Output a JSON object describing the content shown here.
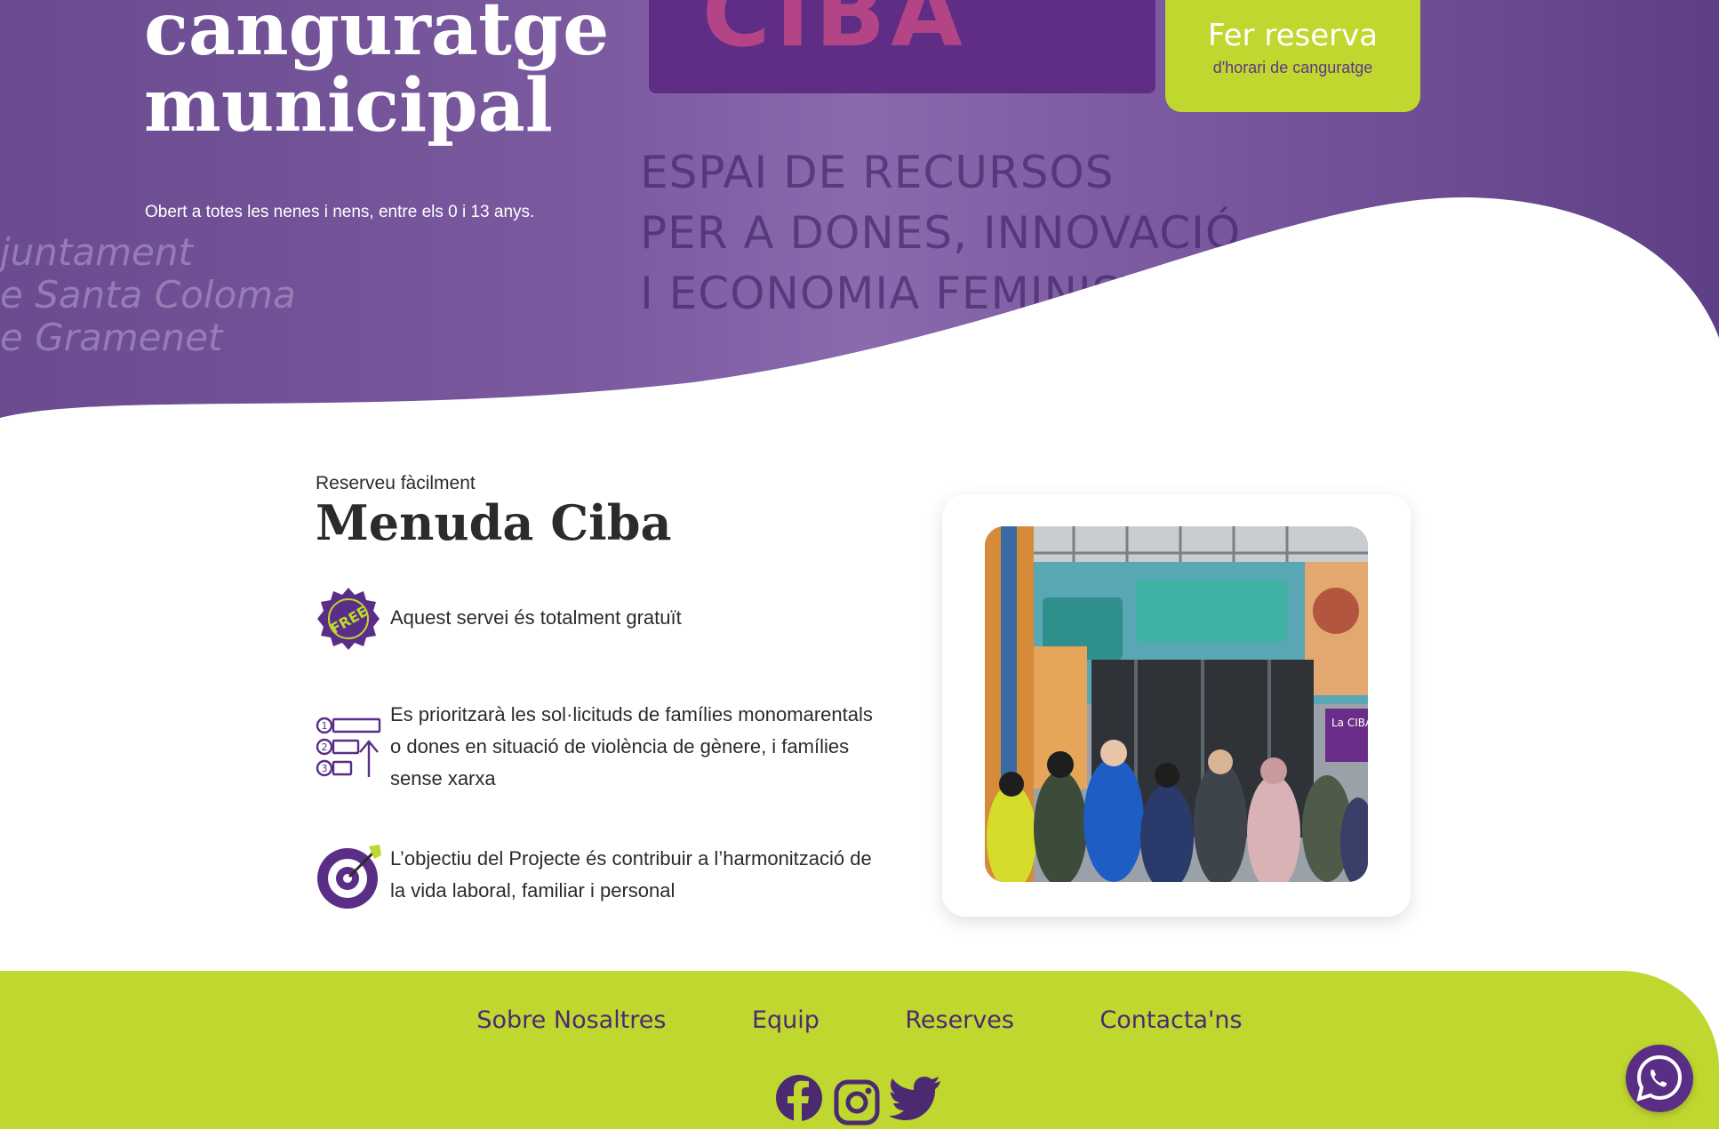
{
  "hero": {
    "title_line1": "canguratge",
    "title_line2": "municipal",
    "subtitle": "Obert a totes les nenes i nens, entre els 0 i 13 anys.",
    "background_sign": {
      "top_text": "CIBA",
      "lines": [
        "ESPAI DE RECURSOS",
        "PER A DONES, INNOVACIÓ",
        "I ECONOMIA FEMINISTA"
      ]
    },
    "background_plaque": [
      "juntament",
      "e Santa Coloma",
      "e Gramenet"
    ],
    "reserve_button": {
      "title": "Fer reserva",
      "subtitle": "d'horari de canguratge"
    }
  },
  "main": {
    "kicker": "Reserveu fàcilment",
    "title": "Menuda Ciba",
    "features": [
      {
        "icon": "free-badge-icon",
        "text": "Aquest servei és totalment gratuït"
      },
      {
        "icon": "priority-list-icon",
        "text": "Es prioritzarà les sol·licituds de famílies monomarentals o dones en situació de violència de gènere, i famílies sense xarxa"
      },
      {
        "icon": "target-icon",
        "text": "L’objectiu del Projecte és contribuir a l’harmonització de la vida laboral, familiar i personal"
      }
    ],
    "photo": {
      "icon": "building-photo",
      "sign_text": "La CIBA"
    }
  },
  "footer": {
    "nav": [
      "Sobre Nosaltres",
      "Equip",
      "Reserves",
      "Contacta'ns"
    ],
    "socials": [
      "facebook-icon",
      "instagram-icon",
      "twitter-icon"
    ]
  },
  "floating": {
    "icon": "whatsapp-icon"
  },
  "colors": {
    "purple": "#5a2d87",
    "lime": "#bfd72f",
    "hero_overlay": "#7b5aa0",
    "text": "#2b2b2b"
  }
}
